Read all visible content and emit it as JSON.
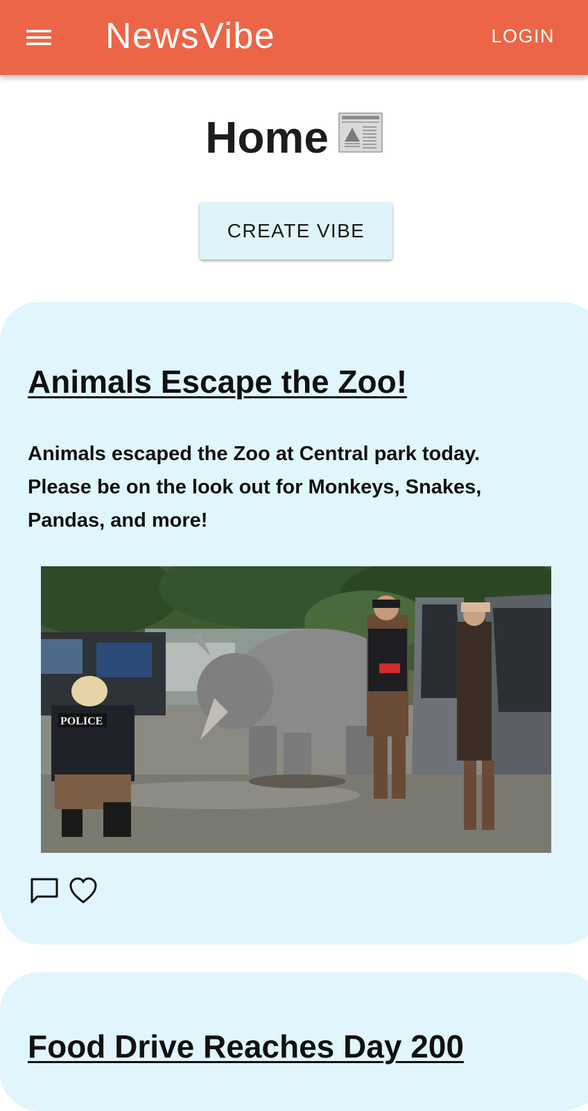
{
  "appbar": {
    "menu_icon": "hamburger-menu-icon",
    "brand": "NewsVibe",
    "login_label": "LOGIN",
    "color": "#ec6547"
  },
  "page": {
    "title": "Home",
    "title_emoji_icon": "newspaper-icon",
    "create_label": "CREATE VIBE"
  },
  "posts": [
    {
      "title": "Animals Escape the Zoo!",
      "body": "Animals escaped the Zoo at Central park today. Please be on the look out for Monkeys, Snakes, Pandas, and more!",
      "image_icon": "rhino-police-photo",
      "actions": [
        "comment-icon",
        "heart-icon"
      ],
      "card_color": "#e0f5fc"
    },
    {
      "title": "Food Drive Reaches Day 200"
    }
  ]
}
